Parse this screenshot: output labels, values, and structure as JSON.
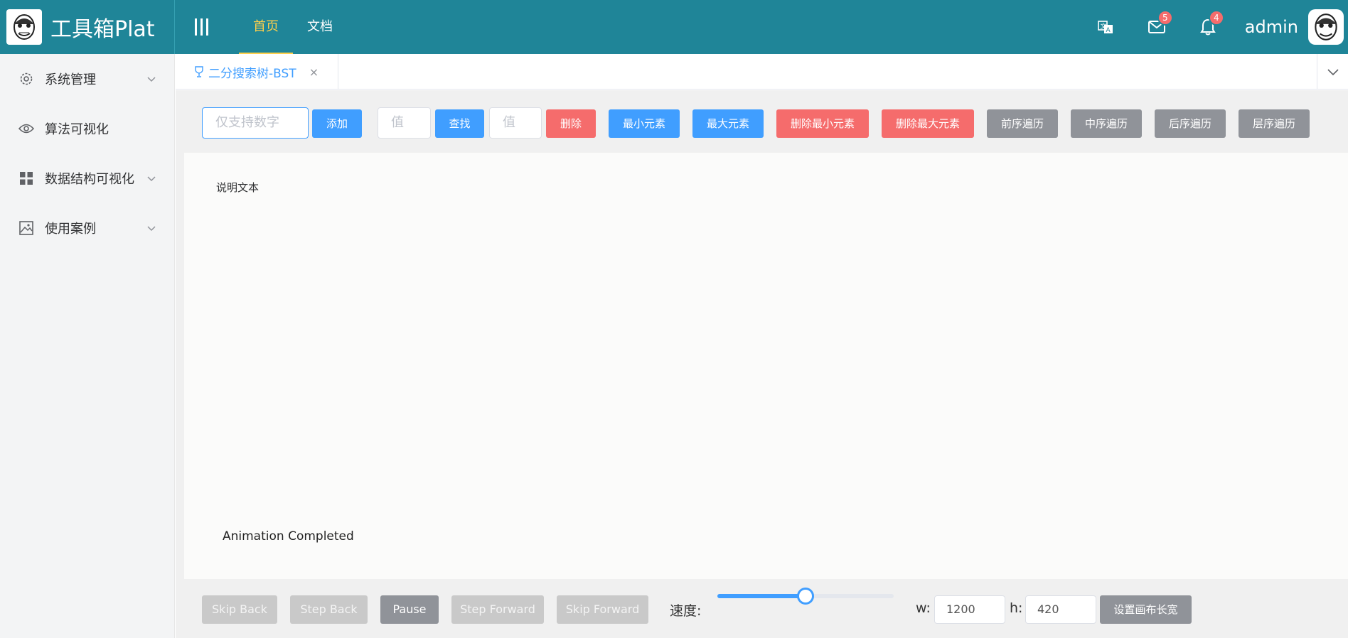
{
  "app": {
    "title": "工具箱Plat",
    "logo_icon": "monkey-avatar-icon"
  },
  "top_nav": {
    "menu_toggle_icon": "menu-bars-icon",
    "items": [
      {
        "label": "首页",
        "active": true
      },
      {
        "label": "文档",
        "active": false
      }
    ]
  },
  "header_right": {
    "translate_icon": "translate-icon",
    "mail_badge": "5",
    "bell_badge": "4",
    "username": "admin",
    "badge_color": "#f56c6c"
  },
  "sidebar": {
    "items": [
      {
        "label": "系统管理",
        "icon": "gear-icon",
        "expandable": true
      },
      {
        "label": "算法可视化",
        "icon": "eye-icon",
        "expandable": false
      },
      {
        "label": "数据结构可视化",
        "icon": "grid-icon",
        "expandable": true
      },
      {
        "label": "使用案例",
        "icon": "picture-icon",
        "expandable": true
      }
    ]
  },
  "tabs": {
    "items": [
      {
        "label": "二分搜索树-BST",
        "icon": "trophy-icon",
        "active": true
      }
    ]
  },
  "toolbar": {
    "add_placeholder": "仅支持数字",
    "add_label": "添加",
    "find_placeholder": "值",
    "find_label": "查找",
    "delete_placeholder": "值",
    "delete_label": "删除",
    "min_label": "最小元素",
    "max_label": "最大元素",
    "delete_min_label": "删除最小元素",
    "delete_max_label": "删除最大元素",
    "preorder_label": "前序遍历",
    "inorder_label": "中序遍历",
    "postorder_label": "后序遍历",
    "levelorder_label": "层序遍历"
  },
  "canvas": {
    "description": "说明文本",
    "status": "Animation Completed"
  },
  "controls": {
    "skip_back": "Skip Back",
    "step_back": "Step Back",
    "pause": "Pause",
    "step_forward": "Step Forward",
    "skip_forward": "Skip Forward",
    "speed_label": "速度:",
    "speed_value": 0.5,
    "w_label": "w:",
    "w_value": "1200",
    "h_label": "h:",
    "h_value": "420",
    "set_size_label": "设置画布长宽"
  },
  "colors": {
    "header": "#1f8598",
    "primary": "#409eff",
    "danger": "#f56c6c",
    "info": "#909399",
    "active_nav": "#ffd04b"
  }
}
